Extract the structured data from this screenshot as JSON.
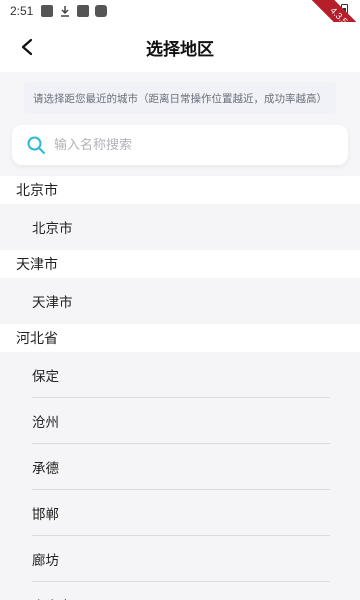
{
  "status_bar": {
    "time": "2:51"
  },
  "debug_badge": "4.3.5",
  "header": {
    "title": "选择地区"
  },
  "notice": "请选择距您最近的城市（距离日常操作位置越近，成功率越高）",
  "search": {
    "placeholder": "输入名称搜索",
    "value": ""
  },
  "sections": [
    {
      "province": "北京市",
      "cities": [
        "北京市"
      ]
    },
    {
      "province": "天津市",
      "cities": [
        "天津市"
      ]
    },
    {
      "province": "河北省",
      "cities": [
        "保定",
        "沧州",
        "承德",
        "邯郸",
        "廊坊",
        "秦皇岛"
      ]
    }
  ],
  "colors": {
    "search_icon": "#2bb8d6",
    "list_bg": "#f5f5f7"
  }
}
